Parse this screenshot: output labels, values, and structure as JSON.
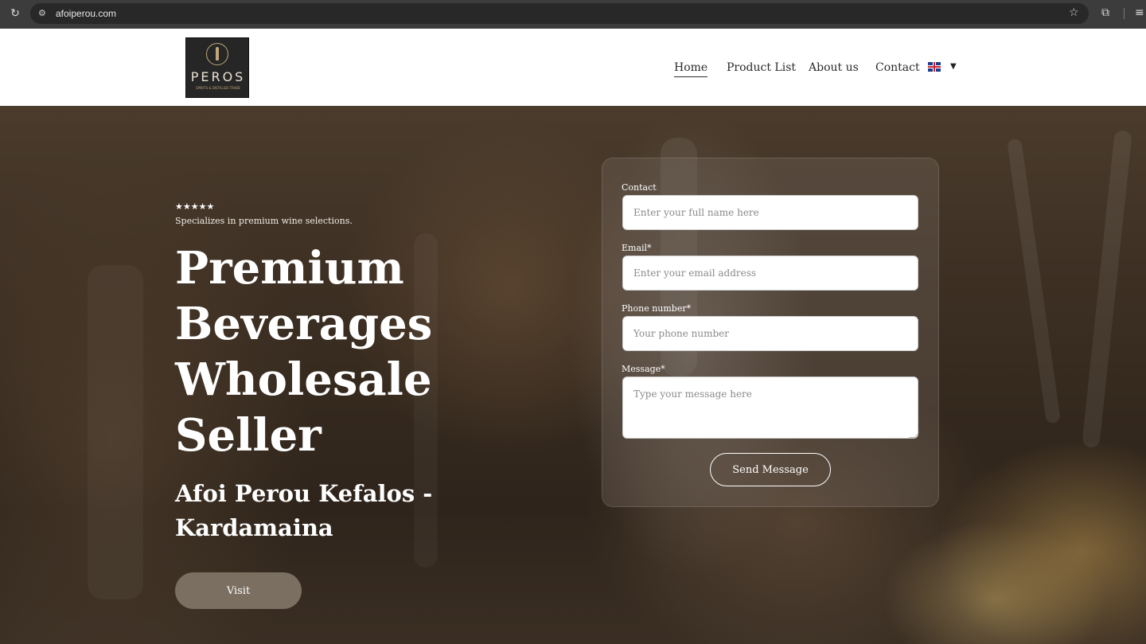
{
  "browser": {
    "url": "afoiperou.com",
    "icons": {
      "reload": "reload-icon",
      "site_info": "site-info-icon",
      "bookmark": "star-icon",
      "extensions": "puzzle-icon",
      "menu": "menu-icon"
    }
  },
  "header": {
    "logo": {
      "wordmark": "PEROS",
      "tagline": "SPIRITS & DISTILLED TRADE"
    },
    "nav": [
      {
        "label": "Home",
        "active": true
      },
      {
        "label": "Product List",
        "active": false
      },
      {
        "label": "About us",
        "active": false
      },
      {
        "label": "Contact",
        "active": false
      }
    ],
    "language": {
      "icon": "uk-flag-icon",
      "caret": "▼"
    }
  },
  "hero": {
    "rating": "★★★★★",
    "tagline": "Specializes in premium wine selections.",
    "title_lines": [
      "Premium",
      "Beverages",
      "Wholesale",
      "Seller"
    ],
    "subtitle": "Afoi Perou Kefalos - Kardamaina",
    "visit_label": "Visit"
  },
  "form": {
    "fields": [
      {
        "label": "Contact",
        "placeholder": "Enter your full name here"
      },
      {
        "label": "Email*",
        "placeholder": "Enter your email address"
      },
      {
        "label": "Phone number*",
        "placeholder": "Your phone number"
      },
      {
        "label": "Message*",
        "placeholder": "Type your message here"
      }
    ],
    "submit_label": "Send Message"
  },
  "colors": {
    "header_bg": "#ffffff",
    "visit_button": "#7a6f60",
    "text_light": "#ffffff",
    "nav_text": "#2b2b2b"
  }
}
